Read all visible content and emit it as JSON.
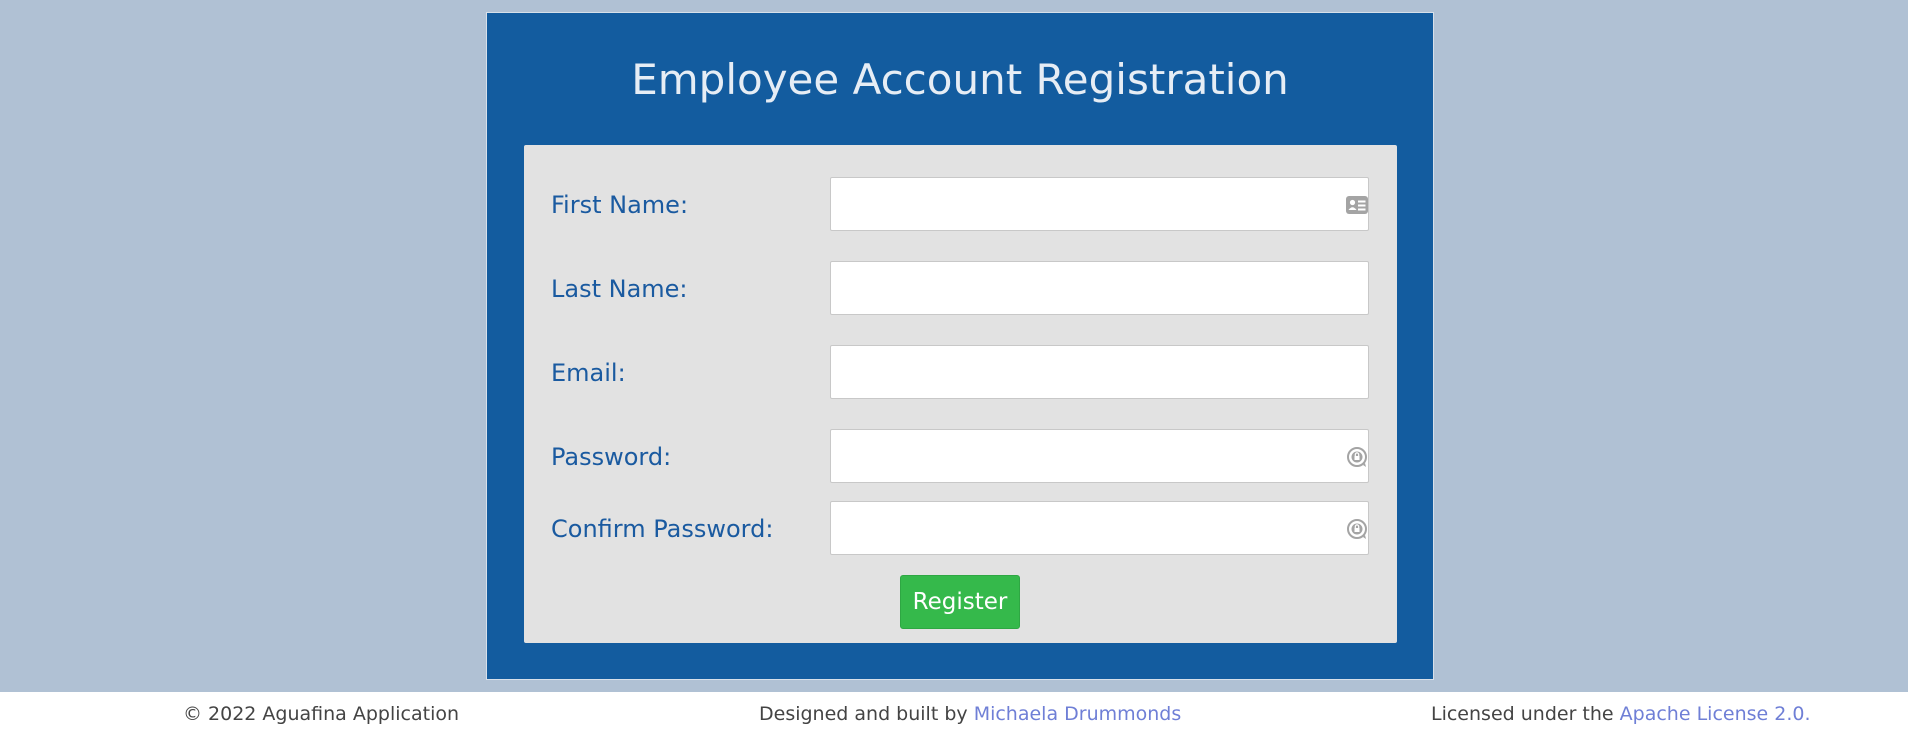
{
  "page": {
    "title": "Employee Account Registration"
  },
  "form": {
    "fields": [
      {
        "label": "First Name:",
        "value": "",
        "placeholder": "",
        "icon": "contact-card-icon"
      },
      {
        "label": "Last Name:",
        "value": "",
        "placeholder": "",
        "icon": ""
      },
      {
        "label": "Email:",
        "value": "",
        "placeholder": "",
        "icon": ""
      },
      {
        "label": "Password:",
        "value": "",
        "placeholder": "",
        "icon": "password-manager-icon"
      },
      {
        "label": "Confirm Password:",
        "value": "",
        "placeholder": "",
        "icon": "password-manager-icon"
      }
    ],
    "submit_label": "Register"
  },
  "footer": {
    "copyright": "© 2022 Aguafina Application",
    "credit_prefix": "Designed and built by",
    "credit_link": "Michaela Drummonds",
    "license_prefix": "Licensed under the",
    "license_link": "Apache License 2.0."
  },
  "colors": {
    "background": "#b0c1d4",
    "card": "#135c9f",
    "panel": "#e2e2e2",
    "label": "#1a5aa0",
    "button": "#35b94b",
    "link": "#6f7fd6"
  }
}
